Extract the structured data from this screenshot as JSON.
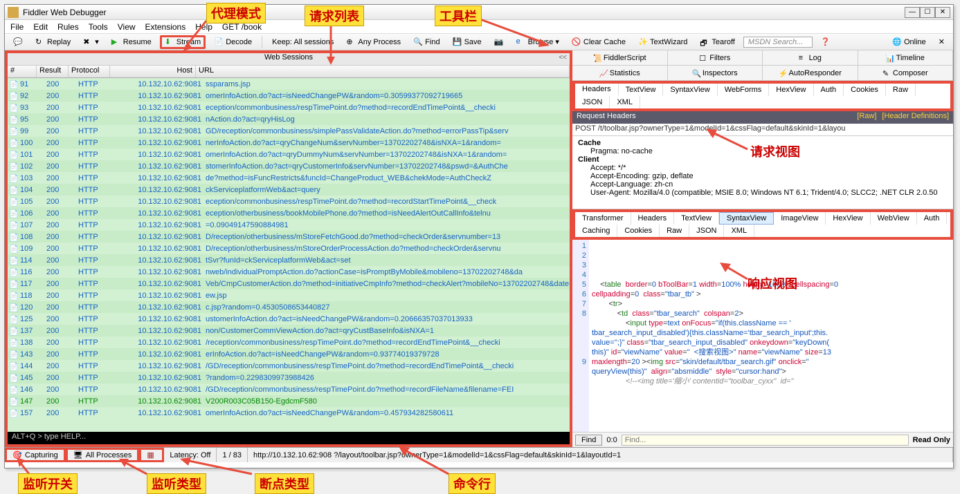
{
  "title": "Fiddler Web Debugger",
  "menus": [
    "File",
    "Edit",
    "Rules",
    "Tools",
    "View",
    "Extensions",
    "Help",
    "GET /book"
  ],
  "toolbar": {
    "replay": "Replay",
    "resume": "Resume",
    "stream": "Stream",
    "decode": "Decode",
    "keep": "Keep: All sessions",
    "any": "Any Process",
    "find": "Find",
    "save": "Save",
    "browse": "Browse",
    "clear": "Clear Cache",
    "wizard": "TextWizard",
    "tearoff": "Tearoff",
    "msdn": "MSDN Search...",
    "online": "Online"
  },
  "websessions": "Web Sessions",
  "cols": {
    "num": "#",
    "res": "Result",
    "pro": "Protocol",
    "host": "Host",
    "url": "URL"
  },
  "host": "10.132.10.62:9081",
  "rows": [
    {
      "n": "91",
      "r": "200",
      "p": "HTTP",
      "u": "                                       ssparams.jsp"
    },
    {
      "n": "92",
      "r": "200",
      "p": "HTTP",
      "u": "                   omerInfoAction.do?act=isNeedChangePW&random=0.30599377092719665"
    },
    {
      "n": "93",
      "r": "200",
      "p": "HTTP",
      "u": "                             eception/commonbusiness/respTimePoint.do?method=recordEndTimePoint&__checki"
    },
    {
      "n": "95",
      "r": "200",
      "p": "HTTP",
      "u": "                             nAction.do?act=qryHisLog"
    },
    {
      "n": "99",
      "r": "200",
      "p": "HTTP",
      "u": "                        GD/reception/commonbusiness/simplePassValidateAction.do?method=errorPassTip&serv"
    },
    {
      "n": "100",
      "r": "200",
      "p": "HTTP",
      "u": "                          nerInfoAction.do?act=qryChangeNum&servNumber=13702202748&isNXA=1&random="
    },
    {
      "n": "101",
      "r": "200",
      "p": "HTTP",
      "u": "                       omerInfoAction.do?act=qryDummyNum&servNumber=13702202748&isNXA=1&random="
    },
    {
      "n": "102",
      "r": "200",
      "p": "HTTP",
      "u": "                    stomerInfoAction.do?act=qryCustomerInfo&servNumber=13702202748&pswd=&AuthChe"
    },
    {
      "n": "103",
      "r": "200",
      "p": "HTTP",
      "u": "                        de?method=isFuncRestricts&funcId=ChangeProduct_WEB&chekMode=AuthCheckZ"
    },
    {
      "n": "104",
      "r": "200",
      "p": "HTTP",
      "u": "                              ckServiceplatformWeb&act=query"
    },
    {
      "n": "105",
      "r": "200",
      "p": "HTTP",
      "u": "                             eception/commonbusiness/respTimePoint.do?method=recordStartTimePoint&__check"
    },
    {
      "n": "106",
      "r": "200",
      "p": "HTTP",
      "u": "                             eception/otherbusiness/bookMobilePhone.do?method=isNeedAlertOutCallInfo&telnu"
    },
    {
      "n": "107",
      "r": "200",
      "p": "HTTP",
      "u": "                           =0.09049147590884981"
    },
    {
      "n": "108",
      "r": "200",
      "p": "HTTP",
      "u": "                        D/reception/otherbusiness/mStoreFetchGood.do?method=checkOrder&servnumber=13"
    },
    {
      "n": "109",
      "r": "200",
      "p": "HTTP",
      "u": "                        D/reception/otherbusiness/mStoreOrderProcessAction.do?method=checkOrder&servnu"
    },
    {
      "n": "114",
      "r": "200",
      "p": "HTTP",
      "u": "                 tSvr?funId=ckServiceplatformWeb&act=set"
    },
    {
      "n": "116",
      "r": "200",
      "p": "HTTP",
      "u": "                      nweb/individualPromptAction.do?actionCase=isPromptByMobile&mobileno=13702202748&da"
    },
    {
      "n": "117",
      "r": "200",
      "p": "HTTP",
      "u": "                    Veb/CmpCustomerAction.do?method=initiativeCmpInfo?method=checkAlert?mobileNo=13702202748&date=We"
    },
    {
      "n": "118",
      "r": "200",
      "p": "HTTP",
      "u": "                       ew.jsp"
    },
    {
      "n": "120",
      "r": "200",
      "p": "HTTP",
      "u": "                   c.jsp?random=0.4530508653440827"
    },
    {
      "n": "125",
      "r": "200",
      "p": "HTTP",
      "u": "                    ustomerInfoAction.do?act=isNeedChangePW&random=0.20666357037013933"
    },
    {
      "n": "137",
      "r": "200",
      "p": "HTTP",
      "u": "                         non/CustomerCommViewAction.do?act=qryCustBaseInfo&isNXA=1"
    },
    {
      "n": "138",
      "r": "200",
      "p": "HTTP",
      "u": "                            /reception/commonbusiness/respTimePoint.do?method=recordEndTimePoint&__checki"
    },
    {
      "n": "143",
      "r": "200",
      "p": "HTTP",
      "u": "                          erInfoAction.do?act=isNeedChangePW&random=0.93774019379728"
    },
    {
      "n": "144",
      "r": "200",
      "p": "HTTP",
      "u": "                     /GD/reception/commonbusiness/respTimePoint.do?method=recordEndTimePoint&__checki"
    },
    {
      "n": "145",
      "r": "200",
      "p": "HTTP",
      "u": "                          ?random=0.2298309973988426"
    },
    {
      "n": "146",
      "r": "200",
      "p": "HTTP",
      "u": "                      /GD/reception/commonbusiness/respTimePoint.do?method=recordFileName&filename=FEI"
    },
    {
      "n": "147",
      "r": "200",
      "p": "HTTP",
      "u": "                  V200R003C05B150-EgdcmF580",
      "g": true
    },
    {
      "n": "157",
      "r": "200",
      "p": "HTTP",
      "u": "                       omerInfoAction.do?act=isNeedChangePW&random=0.457934282580611"
    }
  ],
  "cmd": "ALT+Q > type HELP...",
  "rtabs1": [
    "FiddlerScript",
    "Filters",
    "Log",
    "Timeline"
  ],
  "rtabs2": [
    "Statistics",
    "Inspectors",
    "AutoResponder",
    "Composer"
  ],
  "subtabs": [
    "Headers",
    "TextView",
    "SyntaxView",
    "WebForms",
    "HexView",
    "Auth",
    "Cookies",
    "Raw",
    "JSON",
    "XML"
  ],
  "reqhdr": "Request Headers",
  "rawlink": "[Raw]",
  "hdrdef": "[Header Definitions]",
  "requrl": "POST              /t/toolbar.jsp?ownerType=1&modelId=1&cssFlag=default&skinId=1&layou",
  "req": {
    "cache": "Cache",
    "pragma": "Pragma: no-cache",
    "client": "Client",
    "accept": "Accept: */*",
    "enc": "Accept-Encoding: gzip, deflate",
    "lang": "Accept-Language: zh-cn",
    "ua": "User-Agent: Mozilla/4.0 (compatible; MSIE 8.0; Windows NT 6.1; Trident/4.0; SLCC2; .NET CLR 2.0.50"
  },
  "resptabs": [
    "Transformer",
    "Headers",
    "TextView",
    "SyntaxView",
    "ImageView",
    "HexView",
    "WebView",
    "Auth",
    "Caching",
    "Cookies",
    "Raw",
    "JSON",
    "XML"
  ],
  "find": {
    "btn": "Find",
    "pos": "0:0",
    "ph": "Find...",
    "ro": "Read Only"
  },
  "status": {
    "cap": "Capturing",
    "proc": "All Processes",
    "lat": "Latency: Off",
    "cnt": "1 / 83",
    "url": "http://10.132.10.62:908               ?/layout/toolbar.jsp?ownerType=1&modelId=1&cssFlag=default&skinId=1&layoutId=1"
  },
  "annots": {
    "proxy": "代理模式",
    "reqlist": "请求列表",
    "tb": "工具栏",
    "reqv": "请求视图",
    "respv": "响应视图",
    "listen": "监听开关",
    "ltype": "监听类型",
    "bp": "断点类型",
    "cmdl": "命令行"
  }
}
